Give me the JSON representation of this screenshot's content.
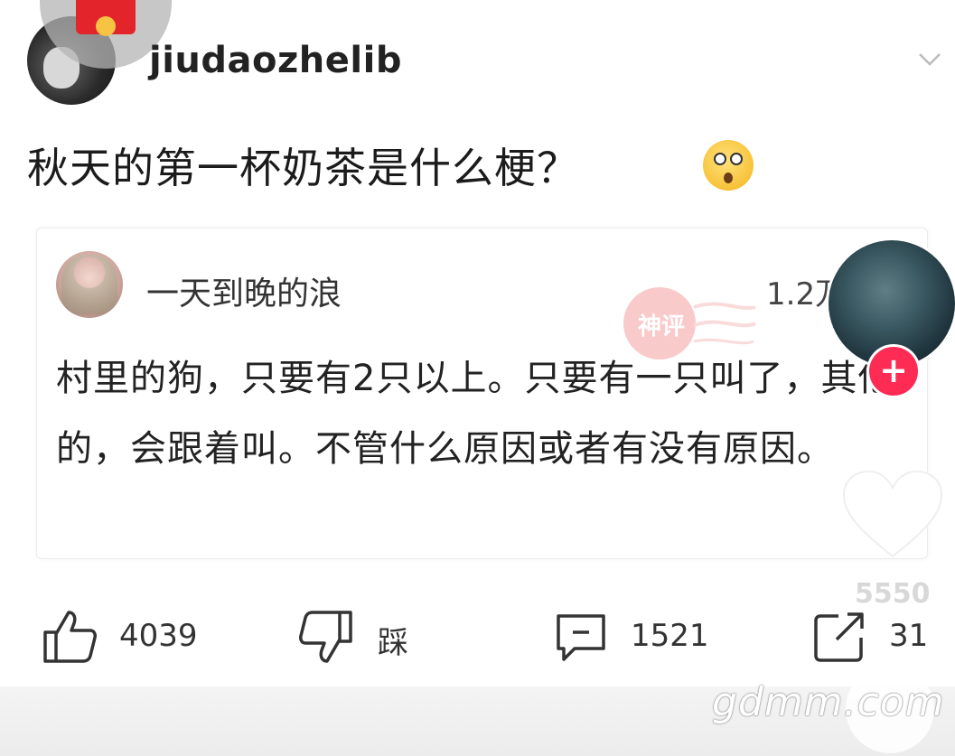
{
  "post": {
    "username": "jiudaozhelib",
    "title": "秋天的第一杯奶茶是什么梗？"
  },
  "comment": {
    "author": "一天到晚的浪",
    "likes": "1.2万",
    "text": "村里的狗，只要有2只以上。只要有一只叫了，其他的，会跟着叫。不管什么原因或者有没有原因。",
    "stamp_text": "神评"
  },
  "side": {
    "like_count": "5550"
  },
  "actions": {
    "like_count": "4039",
    "dislike_label": "踩",
    "comment_count": "1521",
    "share_count": "31"
  },
  "watermark": "gdmm.com",
  "colors": {
    "accent": "#fe2c55",
    "red_packet": "#e3242b"
  }
}
